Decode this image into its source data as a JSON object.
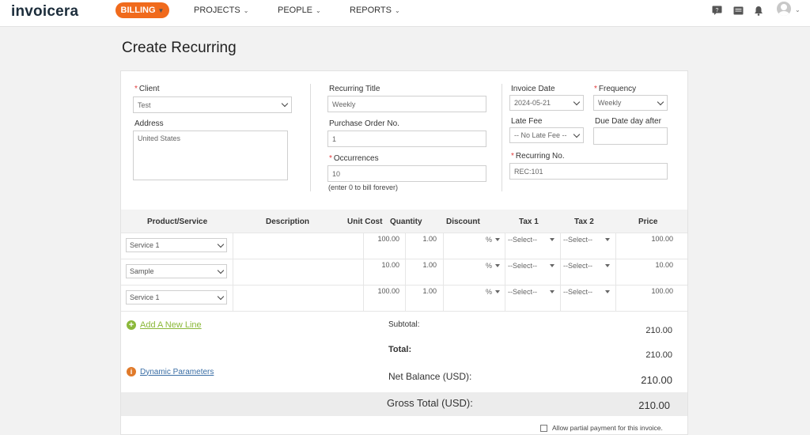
{
  "brand": {
    "name": "invoicera"
  },
  "nav": {
    "billing": "BILLING",
    "projects": "PROJECTS",
    "people": "PEOPLE",
    "reports": "REPORTS"
  },
  "icons": {
    "help": "help-chat-icon",
    "messages": "messages-icon",
    "notifications": "bell-icon",
    "user": "user-avatar-icon"
  },
  "colors": {
    "accent": "#f06a1c",
    "link_green": "#8bb83a",
    "link_blue": "#3a6ea5",
    "info": "#e07a2a",
    "required": "#e23b3b"
  },
  "page_title": "Create Recurring",
  "form": {
    "client_label": "Client",
    "client_value": "Test",
    "address_label": "Address",
    "address_value": "United States",
    "recurring_title_label": "Recurring Title",
    "recurring_title_value": "Weekly",
    "po_label": "Purchase Order No.",
    "po_value": "1",
    "occurrences_label": "Occurrences",
    "occurrences_value": "10",
    "occurrences_hint": "(enter 0 to bill forever)",
    "invoice_date_label": "Invoice Date",
    "invoice_date_value": "2024-05-21",
    "frequency_label": "Frequency",
    "frequency_value": "Weekly",
    "late_fee_label": "Late Fee",
    "late_fee_value": "-- No Late Fee --",
    "due_date_label": "Due Date day after",
    "due_date_value": "",
    "recurring_no_label": "Recurring No.",
    "recurring_no_value": "REC:101"
  },
  "table": {
    "headers": [
      "Product/Service",
      "Description",
      "Unit Cost",
      "Quantity",
      "Discount",
      "Tax 1",
      "Tax 2",
      "Price"
    ],
    "rows": [
      {
        "product": "Service 1",
        "description": "",
        "unit_cost": "100.00",
        "quantity": "1.00",
        "discount_unit": "%",
        "tax1": "--Select--",
        "tax2": "--Select--",
        "price": "100.00"
      },
      {
        "product": "Sample",
        "description": "",
        "unit_cost": "10.00",
        "quantity": "1.00",
        "discount_unit": "%",
        "tax1": "--Select--",
        "tax2": "--Select--",
        "price": "10.00"
      },
      {
        "product": "Service 1",
        "description": "",
        "unit_cost": "100.00",
        "quantity": "1.00",
        "discount_unit": "%",
        "tax1": "--Select--",
        "tax2": "--Select--",
        "price": "100.00"
      }
    ]
  },
  "actions": {
    "add_line": "Add A New Line",
    "dynamic_params": "Dynamic Parameters"
  },
  "totals": {
    "subtotal_label": "Subtotal:",
    "subtotal_value": "210.00",
    "total_label": "Total:",
    "total_value": "210.00",
    "net_balance_label": "Net Balance (USD):",
    "net_balance_value": "210.00",
    "gross_total_label": "Gross Total (USD):",
    "gross_total_value": "210.00"
  },
  "partial_payment_label": "Allow partial payment for this invoice."
}
